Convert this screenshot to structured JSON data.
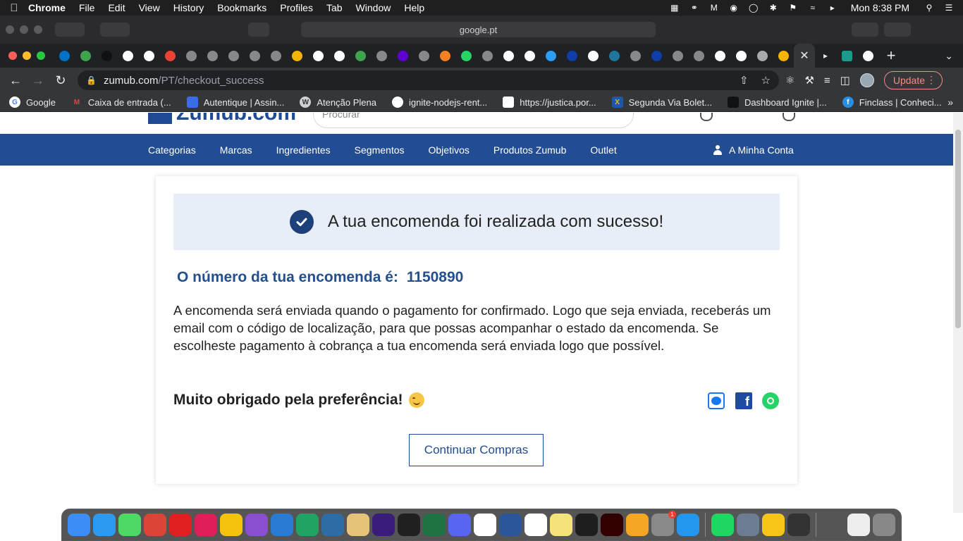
{
  "menubar": {
    "app": "Chrome",
    "items": [
      "File",
      "Edit",
      "View",
      "History",
      "Bookmarks",
      "Profiles",
      "Tab",
      "Window",
      "Help"
    ],
    "clock": "Mon 8:38 PM"
  },
  "safari": {
    "url": "google.pt"
  },
  "toolbar": {
    "url_host": "zumub.com",
    "url_path": "/PT/checkout_success",
    "update_label": "Update"
  },
  "bookmarks": [
    {
      "label": "Google",
      "icon": "google-icon",
      "color": "#ffffff"
    },
    {
      "label": "Caixa de entrada (...",
      "icon": "gmail-icon",
      "color": "#ea4335"
    },
    {
      "label": "Autentique | Assin...",
      "icon": "autentique-icon",
      "color": "#3a6ee8"
    },
    {
      "label": "Atenção Plena",
      "icon": "wordpress-icon",
      "color": "#d0d0d0"
    },
    {
      "label": "ignite-nodejs-rent...",
      "icon": "github-icon",
      "color": "#ffffff"
    },
    {
      "label": "https://justica.por...",
      "icon": "document-icon",
      "color": "#ffffff"
    },
    {
      "label": "Segunda Via Bolet...",
      "icon": "caixa-icon",
      "color": "#1c5aa8"
    },
    {
      "label": "Dashboard Ignite |...",
      "icon": "ignite-icon",
      "color": "#111111"
    },
    {
      "label": "Finclass | Conheci...",
      "icon": "finclass-icon",
      "color": "#2a8de0"
    }
  ],
  "site": {
    "logo_text": "Zumub.com",
    "search_placeholder": "Procurar",
    "nav": [
      "Categorias",
      "Marcas",
      "Ingredientes",
      "Segmentos",
      "Objetivos",
      "Produtos Zumub",
      "Outlet"
    ],
    "account_label": "A Minha Conta",
    "success_message": "A tua encomenda foi realizada com sucesso!",
    "order_label": "O número da tua encomenda é:",
    "order_number": "1150890",
    "description": "A encomenda será enviada quando o pagamento for confirmado. Logo que seja enviada, receberás um email com o código de localização, para que possas acompanhar o estado da encomenda. Se escolheste pagamento à cobrança a tua encomenda será enviada logo que possível.",
    "thanks": "Muito obrigado pela preferência!",
    "continue_label": "Continuar Compras"
  },
  "colors": {
    "brand_blue": "#224d93",
    "order_blue": "#23508c",
    "success_bg": "#e8eef7"
  },
  "tabs_favicon_colors": [
    "#0072c6",
    "#3fa34d",
    "#111111",
    "#ffffff",
    "#ffffff",
    "#ea4335",
    "#888888",
    "#888888",
    "#888888",
    "#888888",
    "#888888",
    "#f4b400",
    "#ffffff",
    "#ffffff",
    "#3fa34d",
    "#888888",
    "#6001d2",
    "#888888",
    "#f48024",
    "#25d366",
    "#888888",
    "#ffffff",
    "#ffffff",
    "#2a9df4",
    "#0e3fa8",
    "#ffffff",
    "#21759b",
    "#888888",
    "#0e3fa8",
    "#888888",
    "#888888",
    "#ffffff",
    "#ffffff",
    "#aaaaaa",
    "#f4b400"
  ],
  "dock_colors": [
    "#3a8ef6",
    "#2c9af0",
    "#4cd964",
    "#db4437",
    "#e02020",
    "#e01e5a",
    "#f4c20d",
    "#8a4fd1",
    "#2a7bd4",
    "#1fa463",
    "#2d6da3",
    "#e6c27a",
    "#3a1d7a",
    "#202020",
    "#1f7244",
    "#5865f2",
    "#ffffff",
    "#2b579a",
    "#ffffff",
    "#f6e27a",
    "#1e1e1e",
    "#330000",
    "#f5a623",
    "#8a8a8a",
    "#2496ed",
    "#1ed760",
    "#6b7c93",
    "#f5c518",
    "#333333",
    "#555555",
    "#eeeeee",
    "#888888"
  ]
}
